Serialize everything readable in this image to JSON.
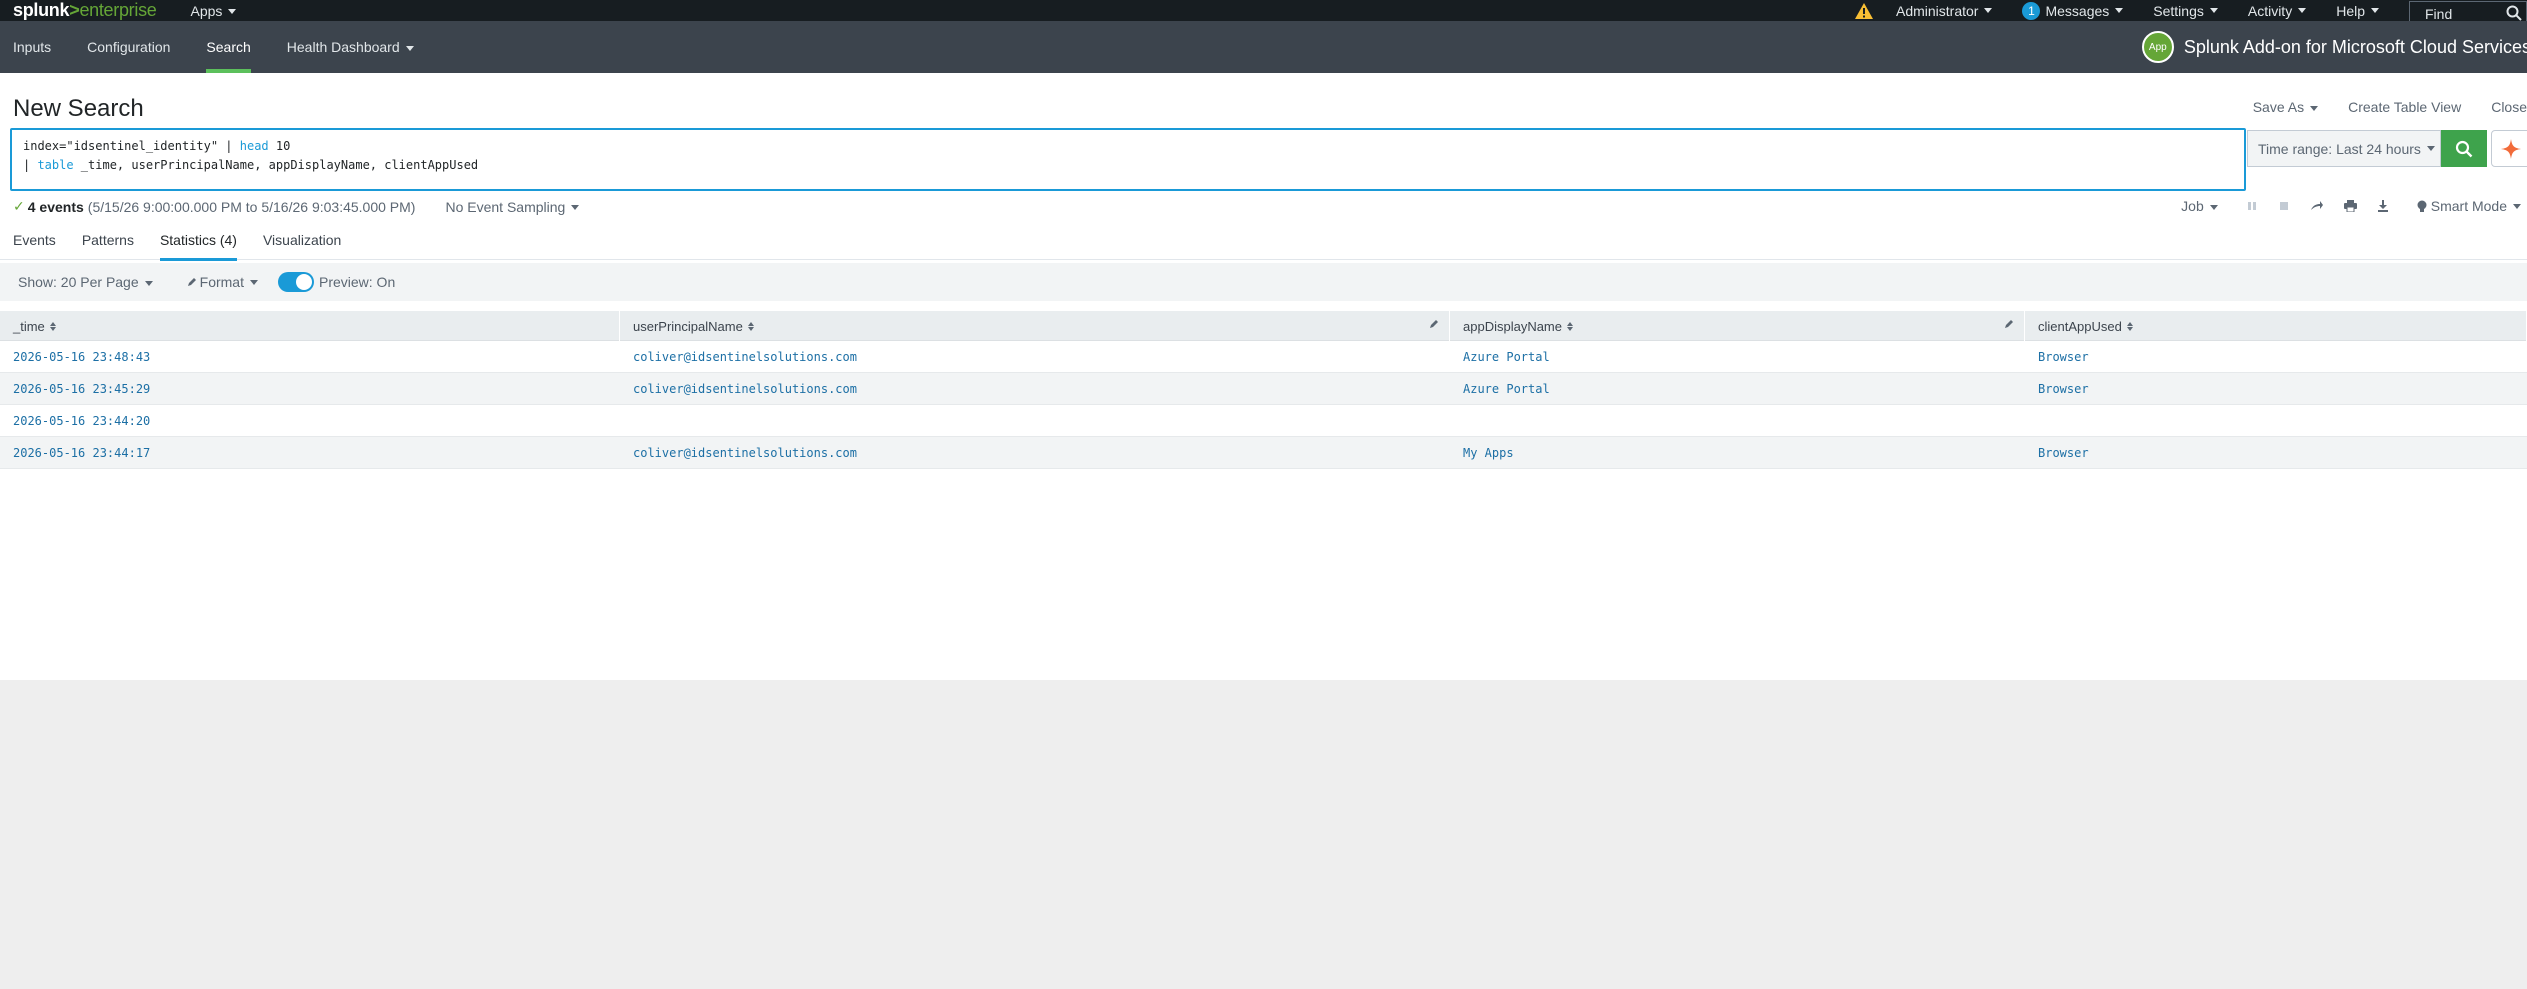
{
  "topbar": {
    "logo": {
      "part1": "splunk",
      "part2": ">",
      "part3": "enterprise"
    },
    "apps_label": "Apps",
    "administrator_label": "Administrator",
    "messages_count": "1",
    "messages_label": "Messages",
    "settings_label": "Settings",
    "activity_label": "Activity",
    "help_label": "Help",
    "find_placeholder": "Find"
  },
  "appbar": {
    "nav": [
      "Inputs",
      "Configuration",
      "Search",
      "Health Dashboard"
    ],
    "active_nav": "Search",
    "app_badge": "App",
    "app_title": "Splunk Add-on for Microsoft Cloud Services"
  },
  "page": {
    "title": "New Search",
    "save_as": "Save As",
    "create_table_view": "Create Table View",
    "close": "Close"
  },
  "search": {
    "line1_part1": "index=\"idsentinel_identity\" | ",
    "line1_kw": "head",
    "line1_part2": " 10",
    "line2_pipe": "| ",
    "line2_kw": "table",
    "line2_rest": " _time, userPrincipalName, appDisplayName, clientAppUsed",
    "time_range": "Time range: Last 24 hours"
  },
  "status": {
    "check": "✓",
    "events_count": "4 events",
    "time_span": "(5/15/26 9:00:00.000 PM to 5/16/26 9:03:45.000 PM)",
    "sampling": "No Event Sampling",
    "job": "Job",
    "mode": "Smart Mode"
  },
  "tabs": [
    "Events",
    "Patterns",
    "Statistics (4)",
    "Visualization"
  ],
  "active_tab": "Statistics (4)",
  "options": {
    "show": "Show: 20 Per Page",
    "format": "Format",
    "preview": "Preview: On"
  },
  "table": {
    "columns": [
      "_time",
      "userPrincipalName",
      "appDisplayName",
      "clientAppUsed"
    ],
    "rows": [
      [
        "2026-05-16 23:48:43",
        "coliver@idsentinelsolutions.com",
        "Azure Portal",
        "Browser"
      ],
      [
        "2026-05-16 23:45:29",
        "coliver@idsentinelsolutions.com",
        "Azure Portal",
        "Browser"
      ],
      [
        "2026-05-16 23:44:20",
        "",
        "",
        ""
      ],
      [
        "2026-05-16 23:44:17",
        "coliver@idsentinelsolutions.com",
        "My Apps",
        "Browser"
      ]
    ]
  },
  "colors": {
    "topbar": "#171d21",
    "appbar": "#3c444d",
    "accent_green": "#65a637",
    "accent_blue": "#1a9ad7",
    "search_button": "#3ea34c"
  }
}
